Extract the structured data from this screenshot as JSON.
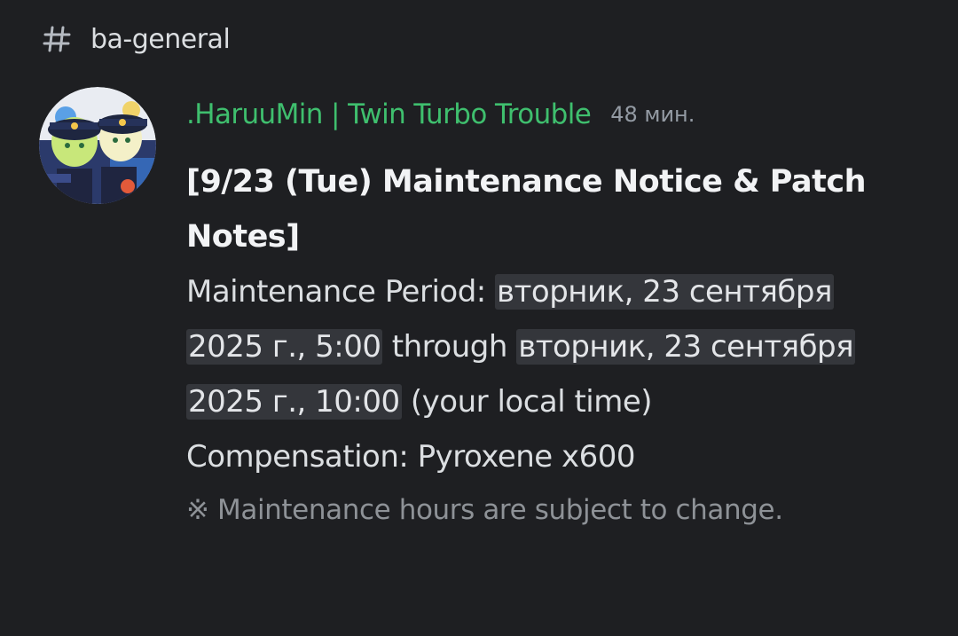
{
  "channel": {
    "icon": "hash-icon",
    "name": "ba-general"
  },
  "message": {
    "author": ".HaruuMin | Twin Turbo Trouble",
    "author_color": "#3fbf6e",
    "timestamp": "48 мин.",
    "title": "[9/23 (Tue) Maintenance Notice & Patch Notes]",
    "period_label": "Maintenance Period: ",
    "period_start": "вторник, 23 сентября 2025 г., 5:00",
    "period_through": " through ",
    "period_end": "вторник, 23 сентября 2025 г., 10:00",
    "period_suffix": " (your local time)",
    "compensation": "Compensation: Pyroxene x600",
    "note": "※ Maintenance hours are subject to change."
  }
}
